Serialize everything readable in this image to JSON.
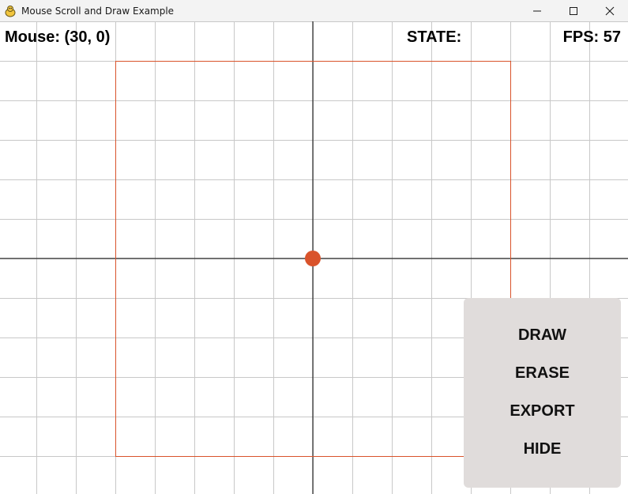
{
  "window": {
    "title": "Mouse Scroll and Draw Example",
    "icon": "pygame-snake-icon",
    "controls": [
      "minimize-icon",
      "maximize-icon",
      "close-icon"
    ]
  },
  "hud": {
    "mouse": "Mouse: (30, 0)",
    "state": "STATE:",
    "fps": "FPS: 57"
  },
  "canvas": {
    "grid_color": "#c8c8c8",
    "axis_color": "#000000",
    "rect_color": "#d9532b",
    "point_color": "#d9532b"
  },
  "menu": {
    "background": "#e0dcdb",
    "items": [
      "DRAW",
      "ERASE",
      "EXPORT",
      "HIDE"
    ]
  }
}
